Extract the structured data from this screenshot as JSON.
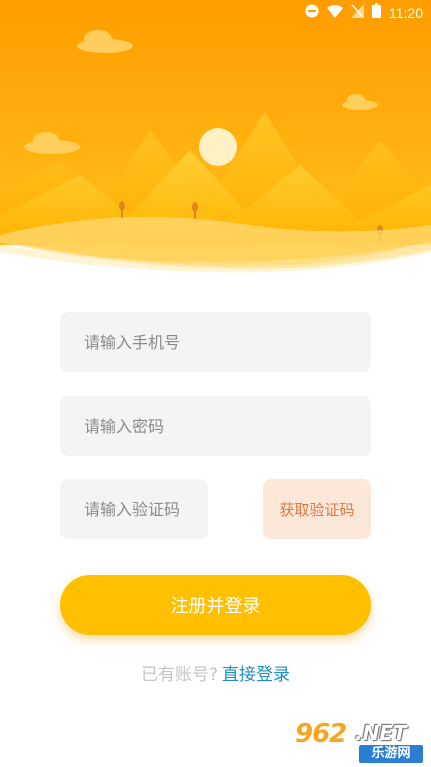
{
  "status_bar": {
    "time": "11:20",
    "icons": [
      "do-not-disturb-icon",
      "wifi-icon",
      "no-signal-icon",
      "battery-icon"
    ]
  },
  "form": {
    "phone_placeholder": "请输入手机号",
    "password_placeholder": "请输入密码",
    "code_placeholder": "请输入验证码",
    "get_code_label": "获取验证码",
    "register_label": "注册并登录"
  },
  "footer": {
    "has_account": "已有账号?",
    "login_link": "直接登录"
  },
  "watermark": {
    "number": "962",
    "domain": ".NET",
    "site_name": "乐游网"
  },
  "colors": {
    "header_orange": "#ffa800",
    "button_yellow": "#ffc000",
    "get_code_bg": "#fde7d8",
    "get_code_text": "#e4763e",
    "link_blue": "#1e8fc2",
    "placeholder_gray": "#8a8a8a"
  }
}
